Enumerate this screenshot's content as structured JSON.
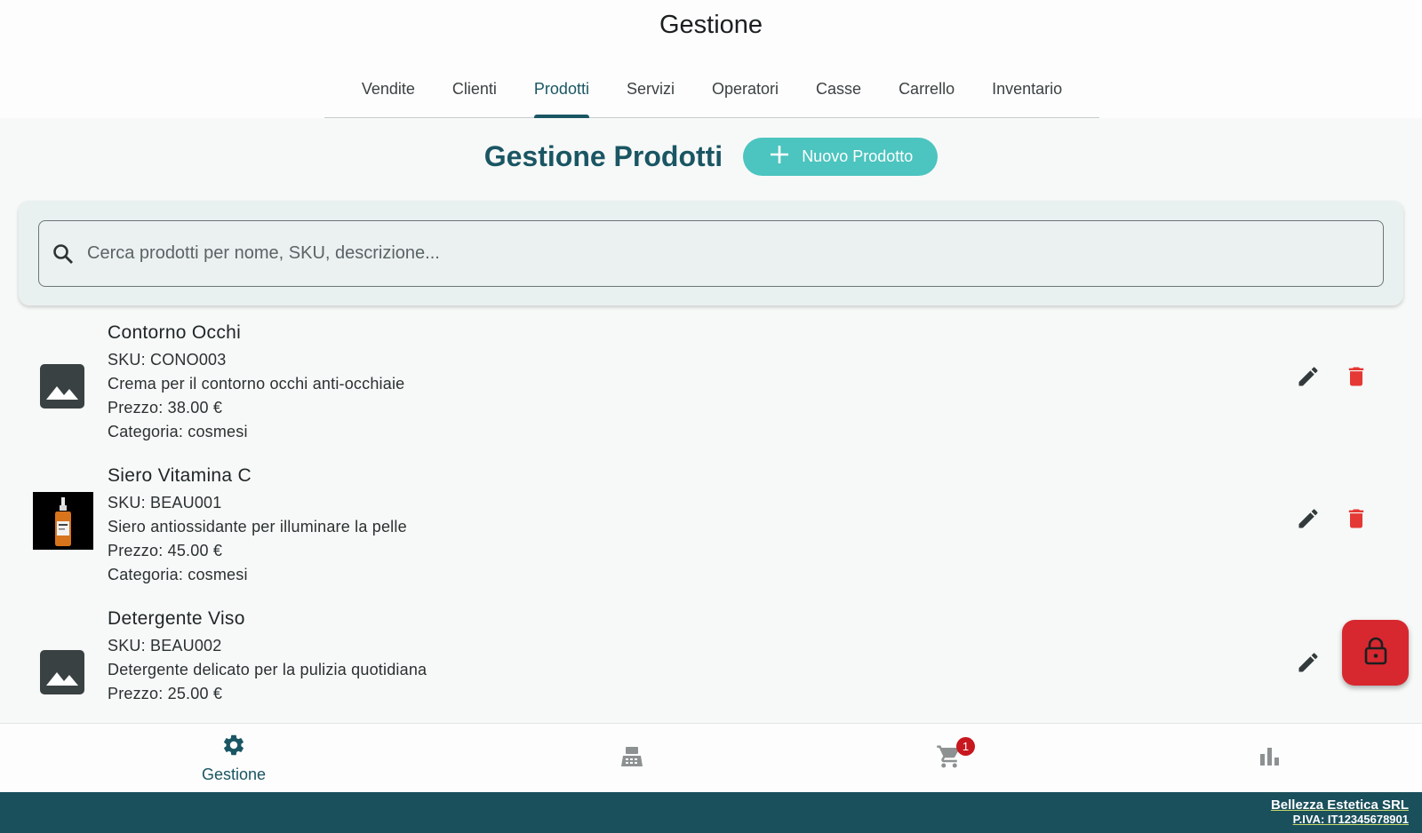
{
  "app": {
    "title": "Gestione"
  },
  "tabs": [
    {
      "label": "Vendite"
    },
    {
      "label": "Clienti"
    },
    {
      "label": "Prodotti",
      "active": true
    },
    {
      "label": "Servizi"
    },
    {
      "label": "Operatori"
    },
    {
      "label": "Casse"
    },
    {
      "label": "Carrello"
    },
    {
      "label": "Inventario"
    }
  ],
  "page": {
    "title": "Gestione Prodotti",
    "new_button_label": "Nuovo Prodotto",
    "new_button_icon": "plus-icon"
  },
  "search": {
    "placeholder": "Cerca prodotti per nome, SKU, descrizione...",
    "value": "",
    "icon": "search-icon"
  },
  "products": [
    {
      "name": "Contorno Occhi",
      "sku": "SKU: CONO003",
      "description": "Crema per il contorno occhi anti-occhiaie",
      "price": "Prezzo: 38.00 €",
      "category": "Categoria: cosmesi",
      "image": "image-placeholder-icon"
    },
    {
      "name": "Siero Vitamina C",
      "sku": "SKU: BEAU001",
      "description": "Siero antiossidante per illuminare la pelle",
      "price": "Prezzo: 45.00 €",
      "category": "Categoria: cosmesi",
      "image": "serum-bottle-photo"
    },
    {
      "name": "Detergente Viso",
      "sku": "SKU: BEAU002",
      "description": "Detergente delicato per la pulizia quotidiana",
      "price": "Prezzo: 25.00 €",
      "image": "image-placeholder-icon"
    }
  ],
  "bottom_nav": {
    "items": [
      {
        "icon": "gear-icon",
        "label": "Gestione",
        "active": true
      },
      {
        "icon": "cash-register-icon"
      },
      {
        "icon": "cart-icon",
        "badge": "1"
      },
      {
        "icon": "bar-chart-icon"
      }
    ]
  },
  "footer": {
    "company": "Bellezza Estetica SRL",
    "vat": "P.IVA: IT12345678901"
  },
  "colors": {
    "primary": "#1a5663",
    "accent": "#4cc4bf",
    "danger": "#e53935",
    "fab": "#d7282f",
    "footer": "#1a4f5c"
  }
}
